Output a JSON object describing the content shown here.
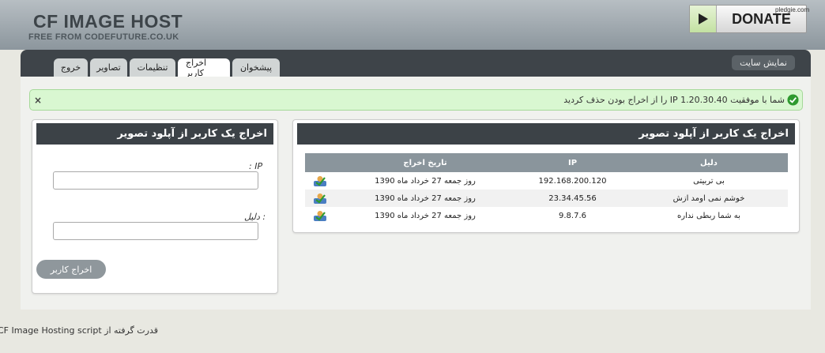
{
  "header": {
    "logo_title": "CF IMAGE HOST",
    "logo_subtitle": "FREE FROM CODEFUTURE.CO.UK",
    "donate_label": "DONATE",
    "watermark": "pledgie.com"
  },
  "nav": {
    "tabs": [
      {
        "label": "پیشخوان"
      },
      {
        "label": "اخراج کاربر",
        "active": true
      },
      {
        "label": "تنظیمات"
      },
      {
        "label": "تصاویر"
      },
      {
        "label": "خروج"
      }
    ],
    "site_button": "نمایش سایت"
  },
  "alert": {
    "message": "شما با موفقیت IP 1.20.30.40 را از اخراج بودن حذف کردید",
    "close_label": "×",
    "icon": "check-circle-icon",
    "color": "#d9f7d1"
  },
  "ban_form": {
    "title": "اخراج یک کاربر از آپلود تصویر",
    "ip_label": ": IP",
    "reason_label": "دلیل :",
    "ip_value": "",
    "reason_value": "",
    "submit_label": "اخراج کاربر"
  },
  "ban_list": {
    "title": "اخراج یک کاربر از آپلود تصویر",
    "columns": {
      "reason": "دلیل",
      "ip": "IP",
      "date": "تاریخ اخراج"
    },
    "rows": [
      {
        "reason": "بی تربیتی",
        "ip": "192.168.200.120",
        "date": "روز جمعه 27 خرداد ماه 1390"
      },
      {
        "reason": "خوشم نمی اومد ازش",
        "ip": "23.34.45.56",
        "date": "روز جمعه 27 خرداد ماه 1390"
      },
      {
        "reason": "به شما ربطی نداره",
        "ip": "9.8.7.6",
        "date": "روز جمعه 27 خرداد ماه 1390"
      }
    ],
    "action_icon": "unban-user-icon"
  },
  "footer": {
    "text": "قدرت گرفته از CF Image Hosting script"
  }
}
